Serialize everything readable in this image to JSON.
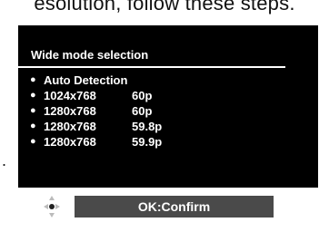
{
  "caption": "esolution, follow these steps.",
  "marker": ".",
  "menu": {
    "title": "Wide mode selection",
    "options": [
      {
        "resolution": "Auto Detection",
        "rate": ""
      },
      {
        "resolution": "1024x768",
        "rate": "60p"
      },
      {
        "resolution": "1280x768",
        "rate": "60p"
      },
      {
        "resolution": "1280x768",
        "rate": "59.8p"
      },
      {
        "resolution": "1280x768",
        "rate": "59.9p"
      }
    ]
  },
  "footer": {
    "nav_icon": "four-way-navigation-icon",
    "confirm_label": "OK:Confirm"
  }
}
